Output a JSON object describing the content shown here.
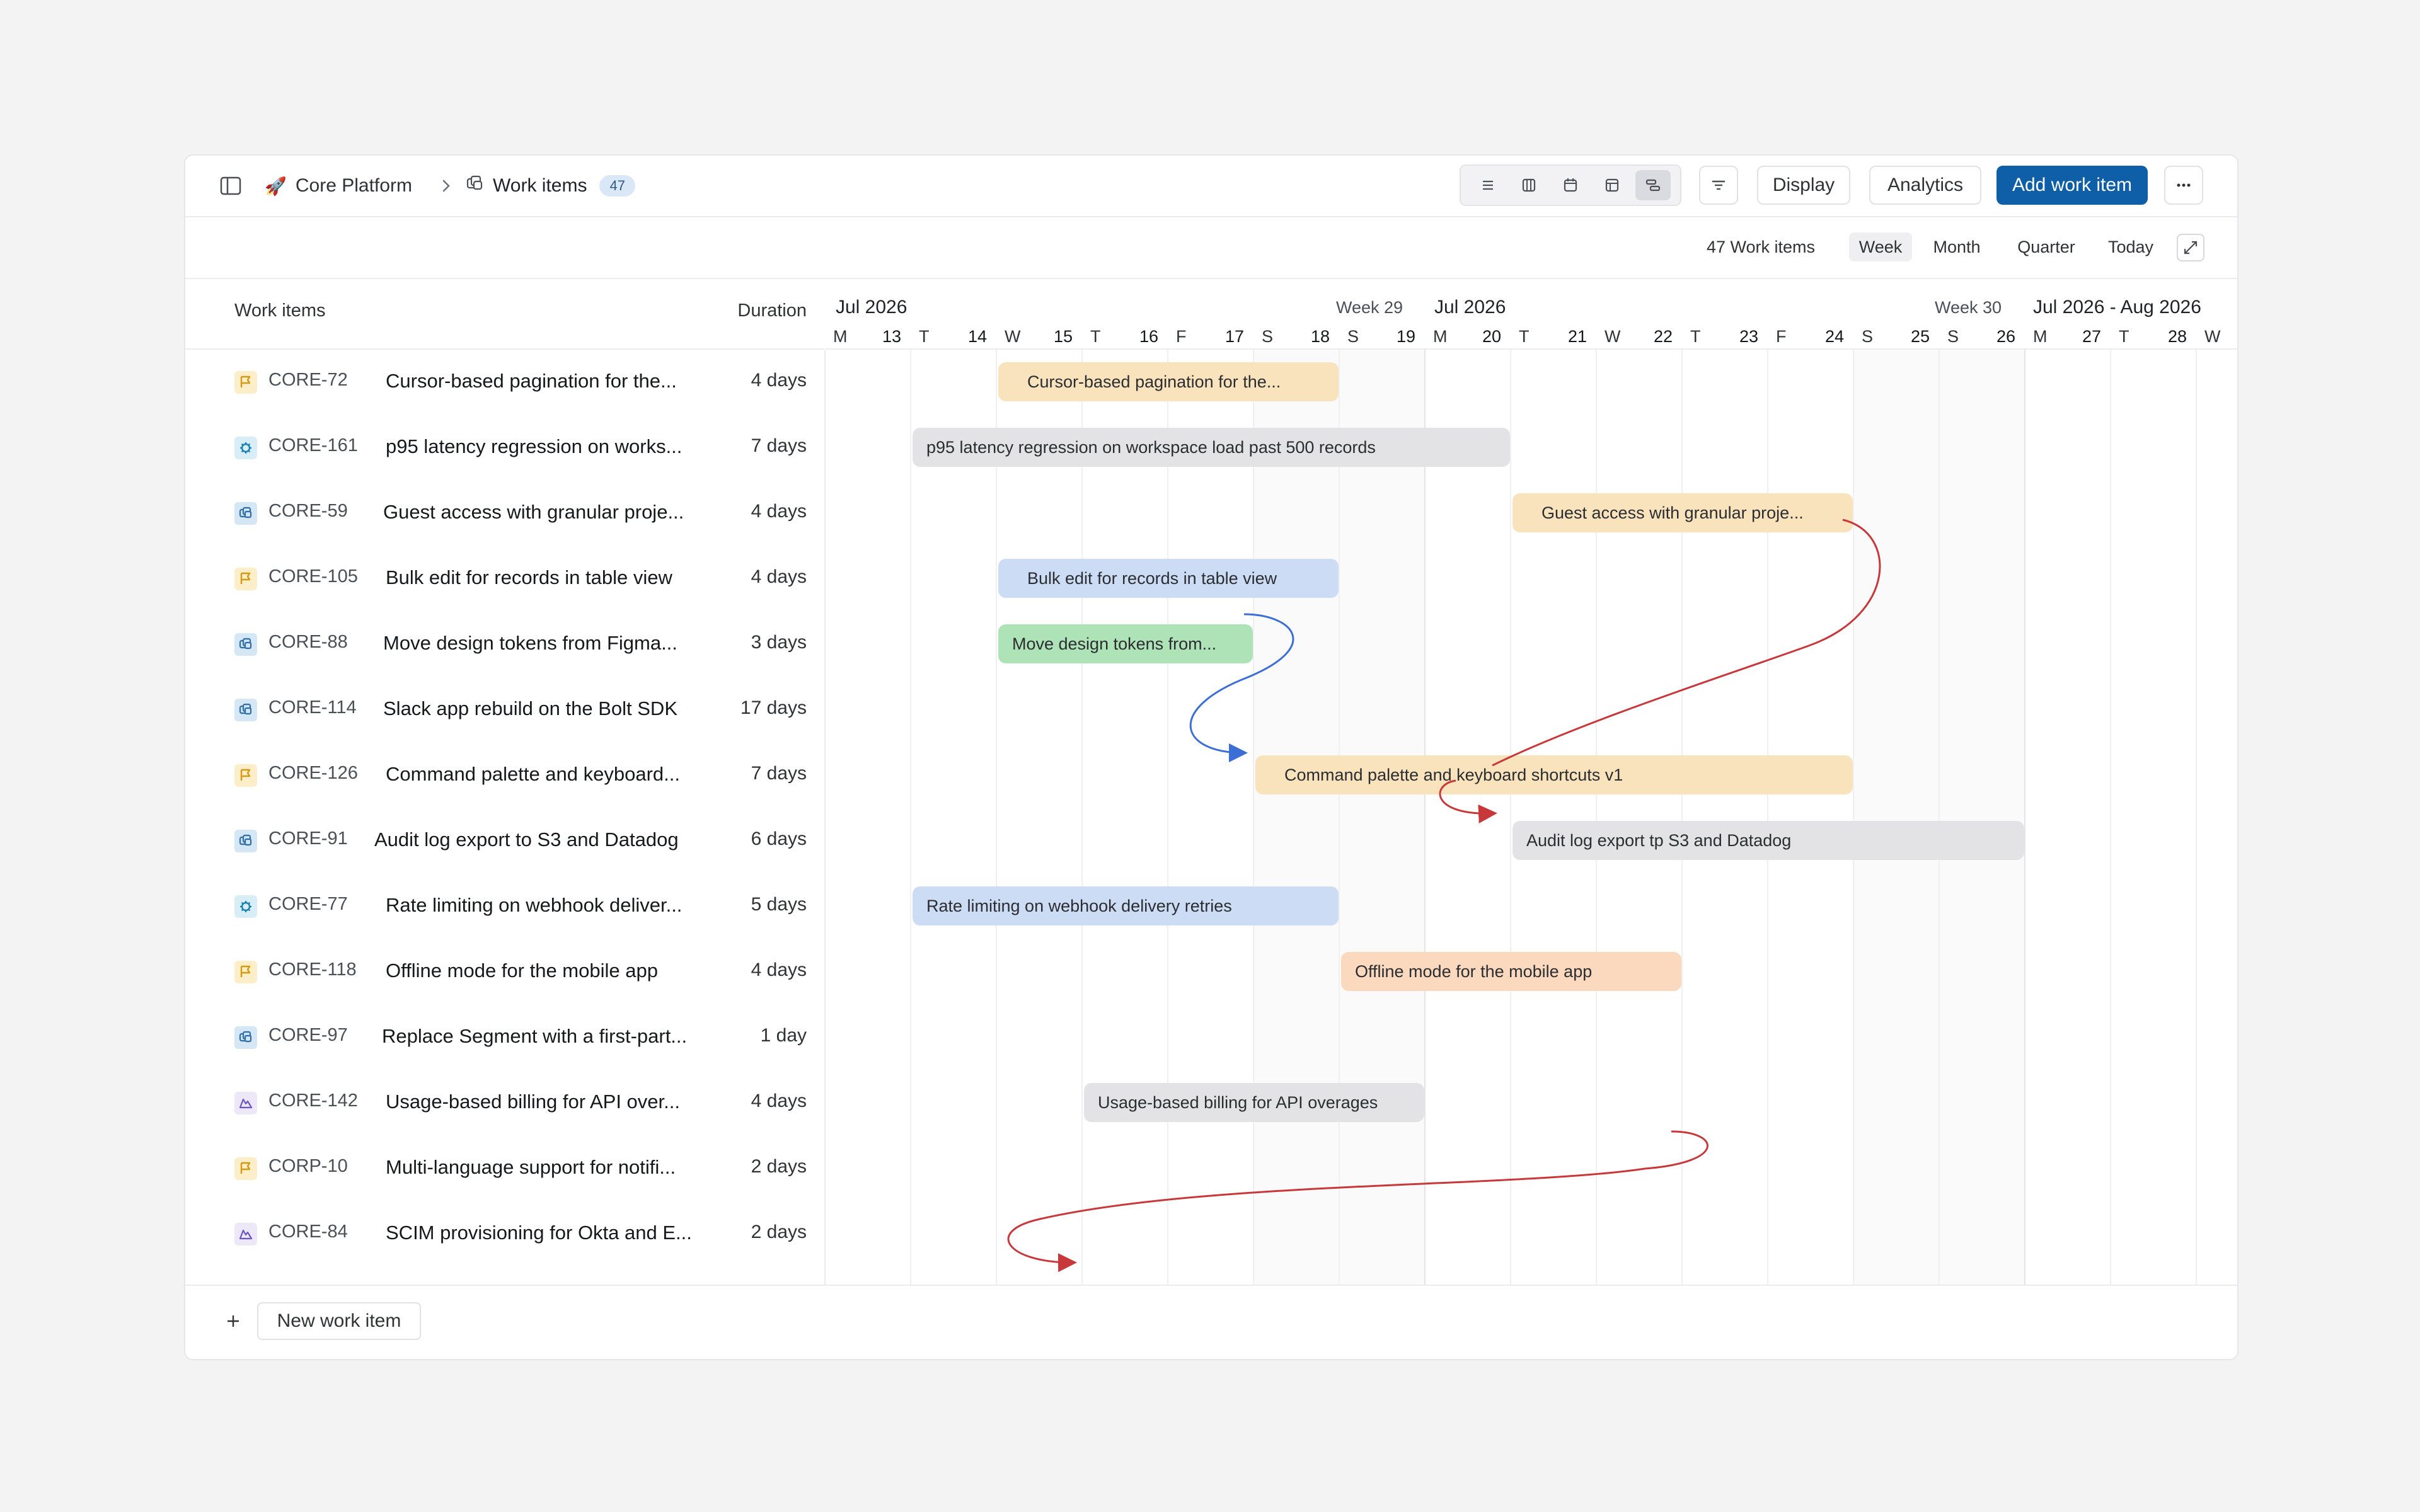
{
  "header": {
    "project_name": "Core Platform",
    "page_name": "Work items",
    "item_count": "47",
    "display_label": "Display",
    "analytics_label": "Analytics",
    "add_label": "Add work item"
  },
  "toolbar": {
    "summary": "47 Work items",
    "week": "Week",
    "month": "Month",
    "quarter": "Quarter",
    "today": "Today",
    "active": "Week"
  },
  "columns": {
    "title": "Work items",
    "duration": "Duration"
  },
  "timeline": {
    "months": [
      "Jul 2026",
      "Jul 2026",
      "Jul 2026 - Aug 2026"
    ],
    "weeks": [
      "Week 29",
      "Week 30"
    ],
    "days": [
      {
        "l": "M",
        "n": "13"
      },
      {
        "l": "T",
        "n": "14"
      },
      {
        "l": "W",
        "n": "15"
      },
      {
        "l": "T",
        "n": "16"
      },
      {
        "l": "F",
        "n": "17"
      },
      {
        "l": "S",
        "n": "18"
      },
      {
        "l": "S",
        "n": "19"
      },
      {
        "l": "M",
        "n": "20"
      },
      {
        "l": "T",
        "n": "21"
      },
      {
        "l": "W",
        "n": "22"
      },
      {
        "l": "T",
        "n": "23"
      },
      {
        "l": "F",
        "n": "24"
      },
      {
        "l": "S",
        "n": "25"
      },
      {
        "l": "S",
        "n": "26"
      },
      {
        "l": "M",
        "n": "27"
      },
      {
        "l": "T",
        "n": "28"
      },
      {
        "l": "W",
        "n": ""
      }
    ]
  },
  "rows": [
    {
      "type": "feature",
      "key": "CORE-72",
      "title": "Cursor-based pagination for the...",
      "duration": "4 days"
    },
    {
      "type": "bug",
      "key": "CORE-161",
      "title": "p95 latency regression on works...",
      "duration": "7 days"
    },
    {
      "type": "story",
      "key": "CORE-59",
      "title": "Guest access with granular proje...",
      "duration": "4 days"
    },
    {
      "type": "feature",
      "key": "CORE-105",
      "title": "Bulk edit for records in table view",
      "duration": "4 days"
    },
    {
      "type": "story",
      "key": "CORE-88",
      "title": "Move design tokens from Figma...",
      "duration": "3 days"
    },
    {
      "type": "story",
      "key": "CORE-114",
      "title": "Slack app rebuild on the Bolt SDK",
      "duration": "17 days"
    },
    {
      "type": "feature",
      "key": "CORE-126",
      "title": "Command palette and keyboard...",
      "duration": "7 days"
    },
    {
      "type": "story",
      "key": "CORE-91",
      "title": "Audit log export to S3 and Datadog",
      "duration": "6 days"
    },
    {
      "type": "bug",
      "key": "CORE-77",
      "title": "Rate limiting on webhook deliver...",
      "duration": "5 days"
    },
    {
      "type": "feature",
      "key": "CORE-118",
      "title": "Offline mode for the mobile app",
      "duration": "4 days"
    },
    {
      "type": "story",
      "key": "CORE-97",
      "title": "Replace Segment with a first-part...",
      "duration": "1 day"
    },
    {
      "type": "epic",
      "key": "CORE-142",
      "title": "Usage-based billing for API over...",
      "duration": "4 days"
    },
    {
      "type": "feature",
      "key": "CORP-10",
      "title": "Multi-language support for notifi...",
      "duration": "2 days"
    },
    {
      "type": "epic",
      "key": "CORE-84",
      "title": "SCIM provisioning for Okta and E...",
      "duration": "2 days"
    }
  ],
  "bars": [
    {
      "row": 0,
      "label": "Cursor-based pagination for the...",
      "color": "yellow"
    },
    {
      "row": 1,
      "label": "p95 latency regression on workspace load past 500 records",
      "color": "gray"
    },
    {
      "row": 2,
      "label": "Guest access with granular proje...",
      "color": "yellow"
    },
    {
      "row": 3,
      "label": "Bulk edit for records in table view",
      "color": "blue"
    },
    {
      "row": 4,
      "label": "Move design tokens from...",
      "color": "green"
    },
    {
      "row": 6,
      "label": "Command palette and keyboard shortcuts v1",
      "color": "yellow"
    },
    {
      "row": 7,
      "label": "Audit log export tp S3 and Datadog",
      "color": "gray"
    },
    {
      "row": 8,
      "label": "Rate limiting on webhook delivery retries",
      "color": "blue2"
    },
    {
      "row": 9,
      "label": "Offline mode for the mobile app",
      "color": "orange"
    },
    {
      "row": 11,
      "label": "Usage-based billing for API overages",
      "color": "gray"
    }
  ],
  "footer": {
    "new_item_label": "New work item"
  },
  "colors": {
    "primary": "#0f5fa8",
    "dep_red": "#c8383a",
    "dep_blue": "#3b6fd6"
  }
}
